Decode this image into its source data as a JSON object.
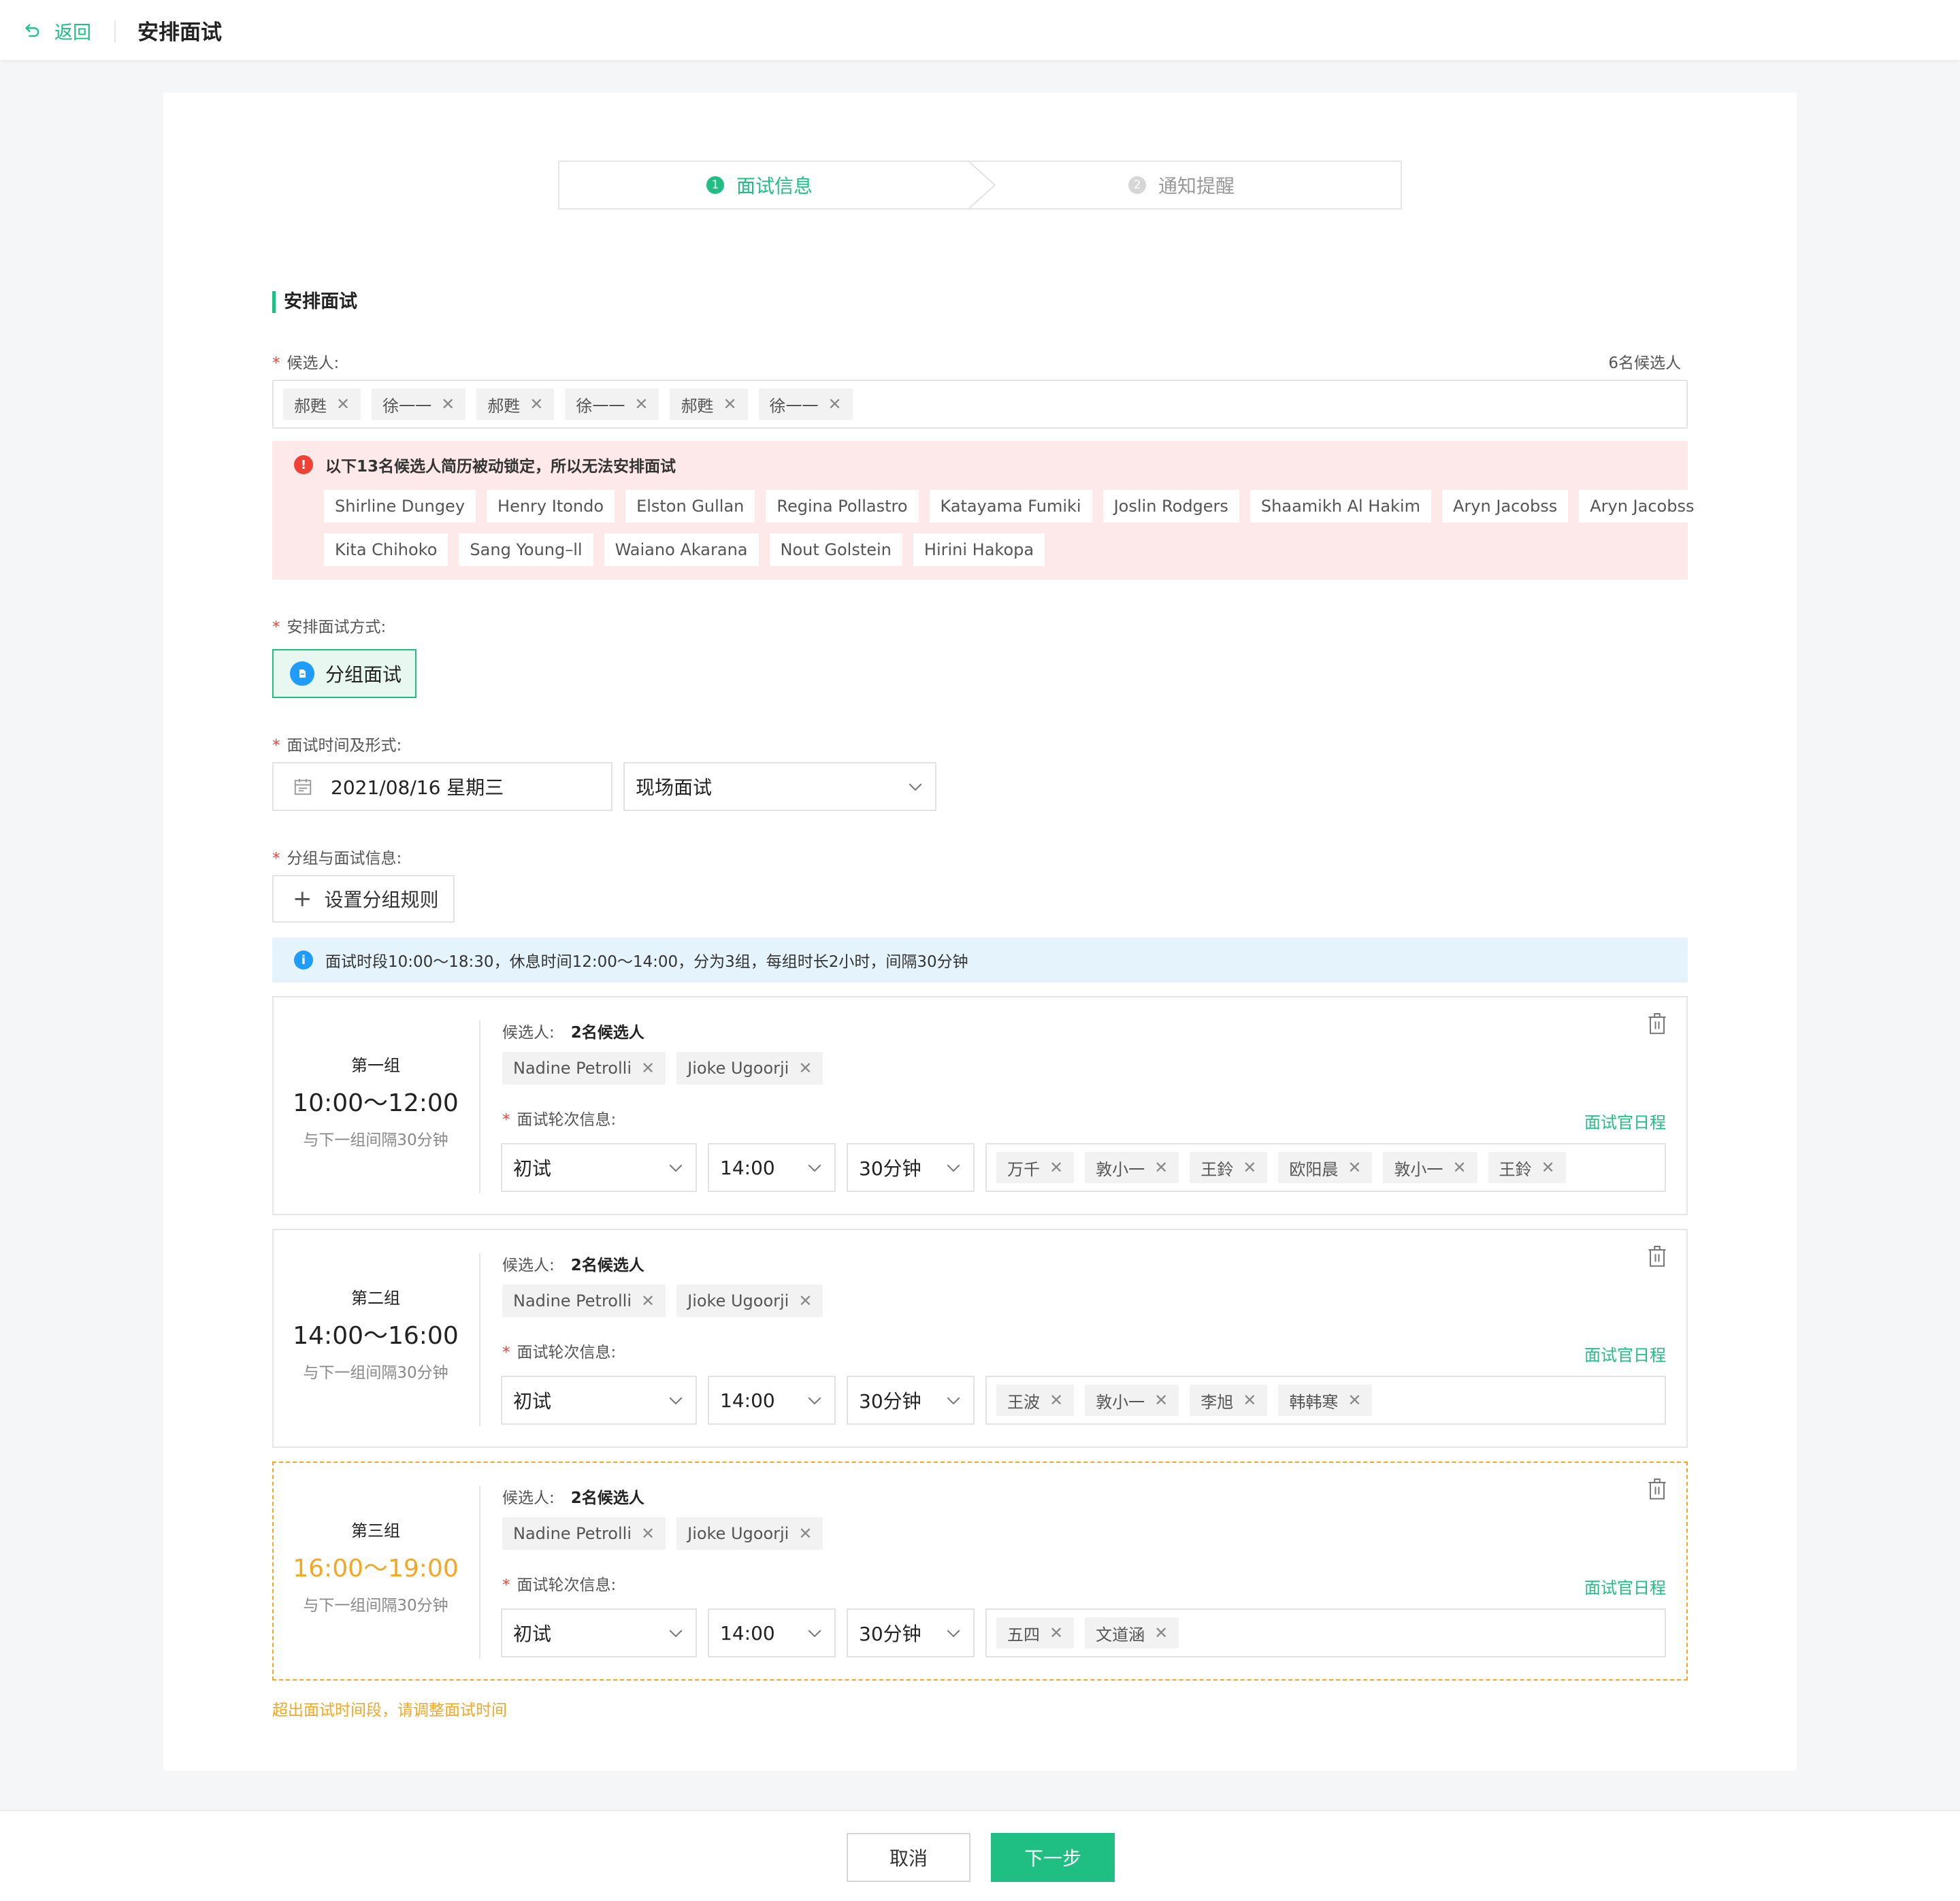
{
  "header": {
    "back_label": "返回",
    "title": "安排面试"
  },
  "steps": [
    {
      "num": "1",
      "label": "面试信息"
    },
    {
      "num": "2",
      "label": "通知提醒"
    }
  ],
  "section_title": "安排面试",
  "candidates": {
    "label": "候选人:",
    "count_text": "6名候选人",
    "tags": [
      "郝甦",
      "徐一一",
      "郝甦",
      "徐一一",
      "郝甦",
      "徐一一"
    ]
  },
  "locked": {
    "icon": "!",
    "message": "以下13名候选人简历被动锁定，所以无法安排面试",
    "row1": [
      "Shirline Dungey",
      "Henry Itondo",
      "Elston Gullan",
      "Regina Pollastro",
      "Katayama Fumiki",
      "Joslin Rodgers",
      "Shaamikh Al Hakim",
      "Aryn Jacobss",
      "Aryn Jacobss"
    ],
    "row2": [
      "Kita Chihoko",
      "Sang Young–ll",
      "Waiano Akarana",
      "Nout Golstein",
      "Hirini Hakopa"
    ]
  },
  "mode": {
    "label": "安排面试方式:",
    "option": "分组面试"
  },
  "time_form": {
    "label": "面试时间及形式:",
    "date": "2021/08/16  星期三",
    "method": "现场面试"
  },
  "grouping": {
    "label": "分组与面试信息:",
    "rule_button": "设置分组规则",
    "info_icon": "i",
    "info": "面试时段10:00～18:30，休息时间12:00～14:00，分为3组，每组时长2小时，间隔30分钟"
  },
  "group_common": {
    "cand_label": "候选人:",
    "round_label": "面试轮次信息:",
    "schedule_link": "面试官日程",
    "gap_text": "与下一组间隔30分钟"
  },
  "groups": [
    {
      "name": "第一组",
      "time": "10:00～12:00",
      "count": "2名候选人",
      "cands": [
        "Nadine Petrolli",
        "Jioke Ugoorji"
      ],
      "round": "初试",
      "start": "14:00",
      "duration": "30分钟",
      "interviewers": [
        "万千",
        "敦小一",
        "王鈴",
        "欧阳晨",
        "敦小一",
        "王鈴"
      ]
    },
    {
      "name": "第二组",
      "time": "14:00～16:00",
      "count": "2名候选人",
      "cands": [
        "Nadine Petrolli",
        "Jioke Ugoorji"
      ],
      "round": "初试",
      "start": "14:00",
      "duration": "30分钟",
      "interviewers": [
        "王波",
        "敦小一",
        "李旭",
        "韩韩寒"
      ]
    },
    {
      "name": "第三组",
      "time": "16:00～19:00",
      "count": "2名候选人",
      "cands": [
        "Nadine Petrolli",
        "Jioke Ugoorji"
      ],
      "round": "初试",
      "start": "14:00",
      "duration": "30分钟",
      "interviewers": [
        "五四",
        "文道涵"
      ]
    }
  ],
  "overtime_warning": "超出面试时间段，请调整面试时间",
  "footer": {
    "cancel": "取消",
    "next": "下一步"
  },
  "colors": {
    "accent": "#1fbf83",
    "error": "#f04134",
    "warning": "#f5a623",
    "info": "#1e9cff"
  }
}
